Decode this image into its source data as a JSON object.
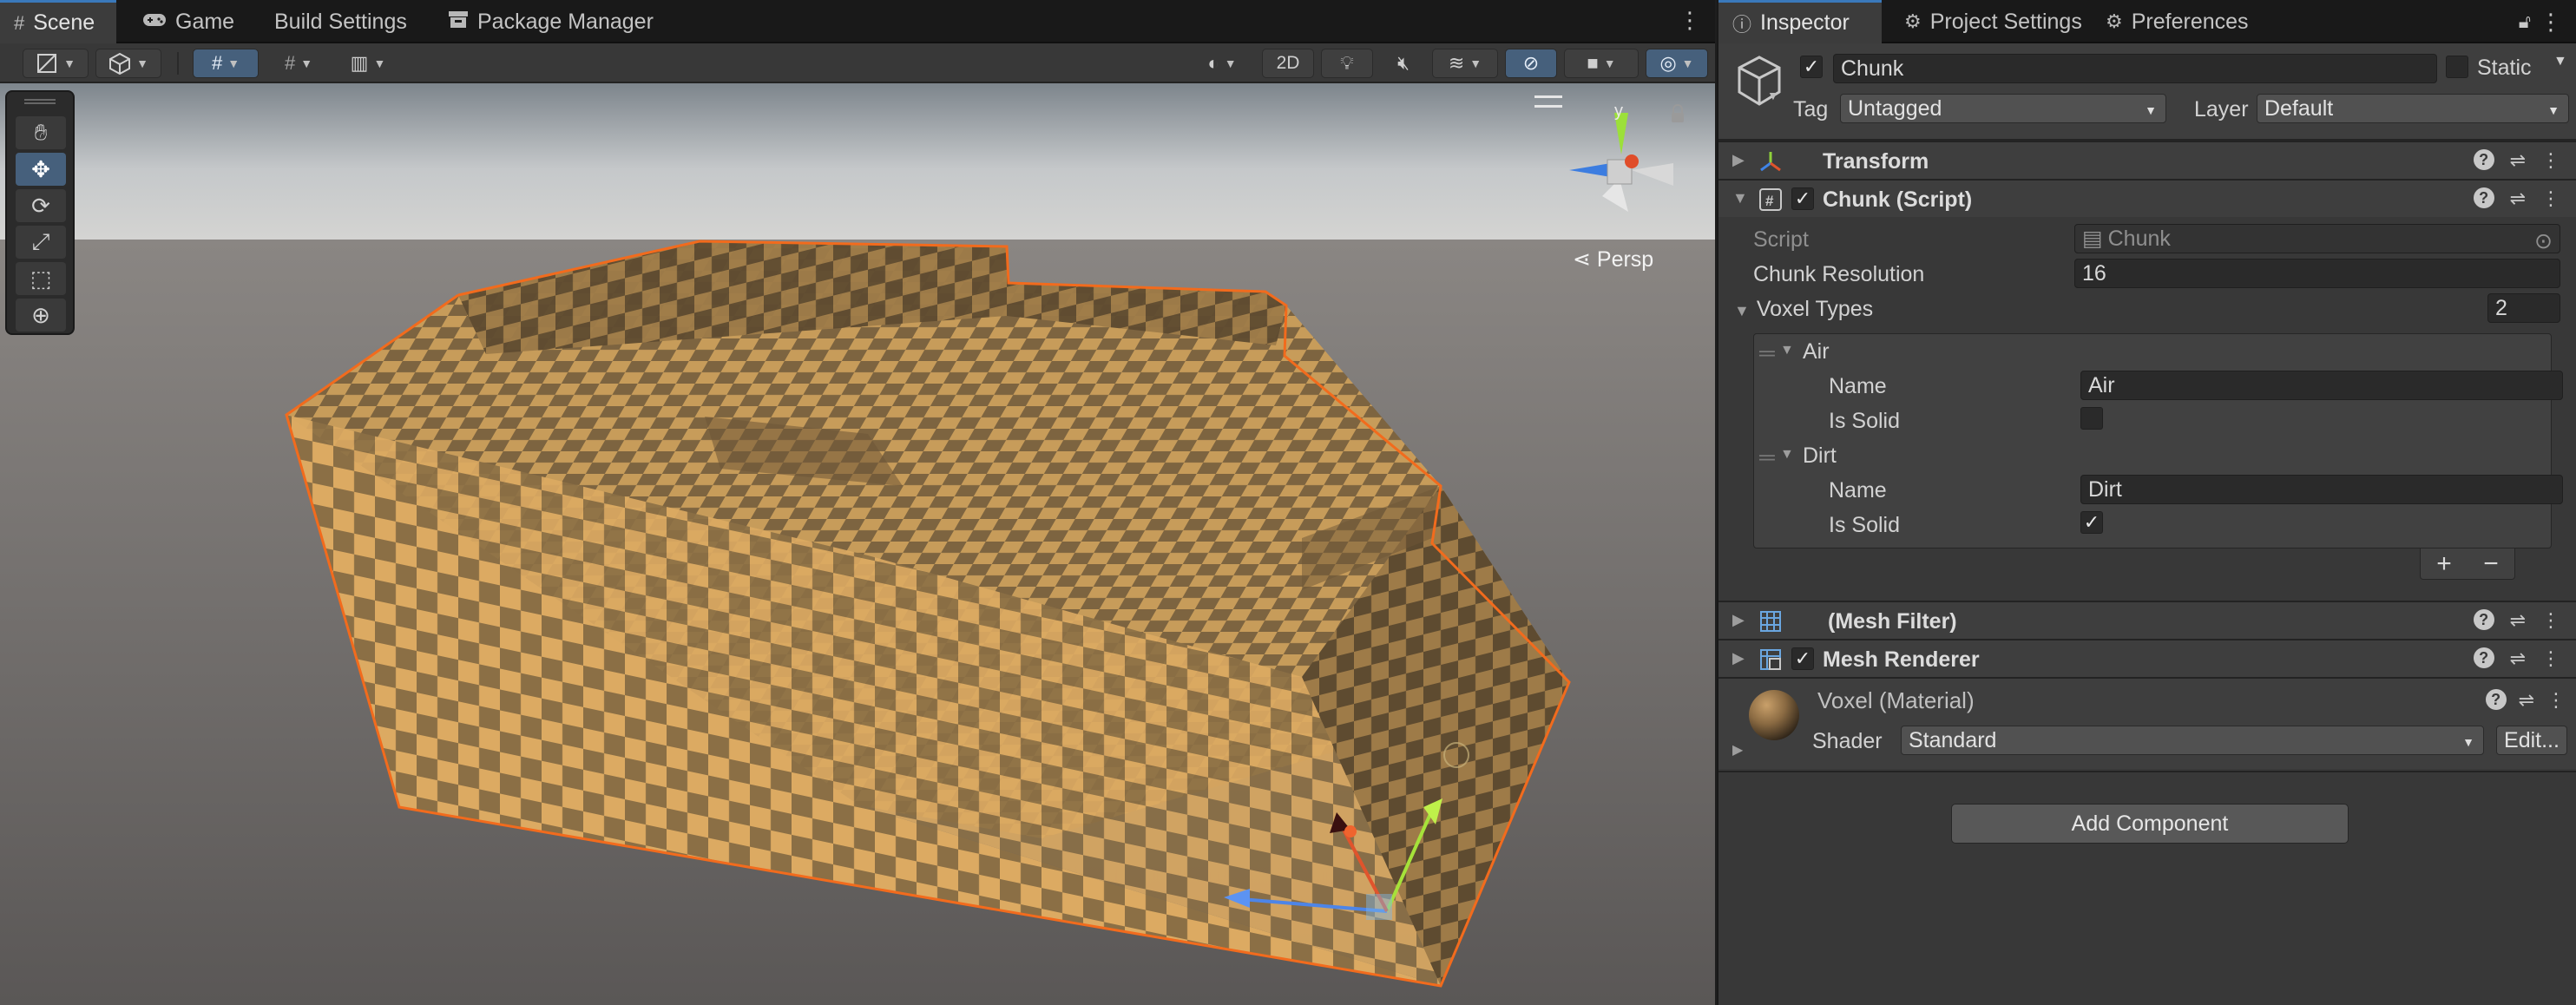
{
  "scene_window": {
    "tabs": [
      {
        "label": "Scene",
        "icon": "hash-grid-icon"
      },
      {
        "label": "Game",
        "icon": "gamepad-icon"
      },
      {
        "label": "Build Settings",
        "icon": ""
      },
      {
        "label": "Package Manager",
        "icon": "package-icon"
      }
    ],
    "toolbar": {
      "toggle_2d_label": "2D"
    },
    "viewport": {
      "projection_label": "Persp",
      "gizmo_y_axis_label": "y",
      "selection_outline_color": "#f26b1d",
      "checker_light_color": "#d7a65d",
      "checker_dark_color": "#7d6440"
    }
  },
  "inspector_window": {
    "tabs": [
      {
        "label": "Inspector",
        "icon": "info-icon"
      },
      {
        "label": "Project Settings",
        "icon": "gear-icon"
      },
      {
        "label": "Preferences",
        "icon": "gear-icon"
      }
    ],
    "game_object": {
      "active": true,
      "name": "Chunk",
      "static_label": "Static",
      "static": false,
      "tag_label": "Tag",
      "tag_value": "Untagged",
      "layer_label": "Layer",
      "layer_value": "Default"
    },
    "components": {
      "transform": {
        "title": "Transform"
      },
      "chunk_script": {
        "title": "Chunk (Script)",
        "enabled": true,
        "script_label": "Script",
        "script_value": "Chunk",
        "resolution_label": "Chunk Resolution",
        "resolution_value": "16",
        "voxel_types_label": "Voxel Types",
        "voxel_types_count": "2",
        "voxel_types": [
          {
            "header": "Air",
            "name_label": "Name",
            "name_value": "Air",
            "solid_label": "Is Solid",
            "is_solid": false
          },
          {
            "header": "Dirt",
            "name_label": "Name",
            "name_value": "Dirt",
            "solid_label": "Is Solid",
            "is_solid": true
          }
        ],
        "add_symbol": "+",
        "remove_symbol": "−"
      },
      "mesh_filter": {
        "title": "(Mesh Filter)"
      },
      "mesh_renderer": {
        "title": "Mesh Renderer",
        "enabled": true
      },
      "material": {
        "title": "Voxel (Material)",
        "shader_label": "Shader",
        "shader_value": "Standard",
        "edit_label": "Edit..."
      }
    },
    "add_component_label": "Add Component"
  }
}
